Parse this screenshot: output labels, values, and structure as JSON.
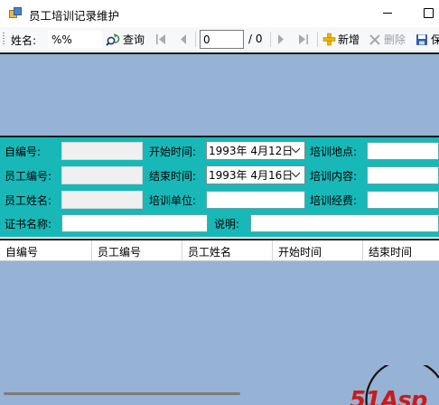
{
  "window": {
    "title": "员工培训记录维护"
  },
  "toolbar": {
    "name_label": "姓名:",
    "name_value": "%%",
    "query_label": "查询",
    "position_value": "0",
    "count_text": "/ 0",
    "add_label": "新增",
    "delete_label": "删除",
    "save_label": "保"
  },
  "form": {
    "auto_id_label": "自编号:",
    "auto_id_value": "",
    "emp_no_label": "员工编号:",
    "emp_no_value": "",
    "emp_name_label": "员工姓名:",
    "emp_name_value": "",
    "cert_label": "证书名称:",
    "cert_value": "",
    "start_label": "开始时间:",
    "start_value": "1993年  4月12日",
    "end_label": "结束时间:",
    "end_value": "1993年  4月16日",
    "unit_label": "培训单位:",
    "unit_value": "",
    "note_label": "说明:",
    "note_value": "",
    "location_label": "培训地点:",
    "location_value": "",
    "content_label": "培训内容:",
    "content_value": "",
    "fee_label": "培训经费:",
    "fee_value": ""
  },
  "grid": {
    "columns": [
      "自编号",
      "员工编号",
      "员工姓名",
      "开始时间",
      "结束时间"
    ]
  },
  "watermark": {
    "text": "51Asp"
  },
  "icons": {
    "query": "refresh-search-icon",
    "first": "first-record-icon",
    "prev": "prev-record-icon",
    "next": "next-record-icon",
    "last": "last-record-icon",
    "add": "plus-icon",
    "delete": "x-delete-icon",
    "save": "floppy-disk-icon"
  },
  "colors": {
    "form_panel": "#19b8b8",
    "grid_background": "#96b2d4",
    "add_icon": "#e8b40a",
    "watermark": "#cc1a1a"
  }
}
